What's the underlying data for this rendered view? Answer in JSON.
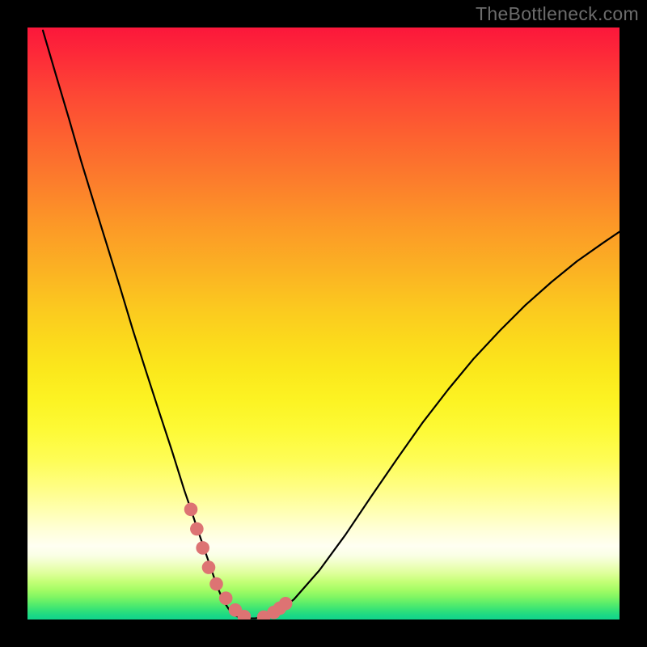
{
  "watermark": "TheBottleneck.com",
  "colors": {
    "page_bg": "#000000",
    "curve_stroke": "#000000",
    "dot_fill": "#dd7373",
    "gradient_top": "#fb173b",
    "gradient_bottom": "#12d48b"
  },
  "chart_data": {
    "type": "line",
    "title": "",
    "xlabel": "",
    "ylabel": "",
    "xlim": [
      0,
      100
    ],
    "ylim": [
      0,
      100
    ],
    "grid": false,
    "series": [
      {
        "name": "bottleneck-curve",
        "x": [
          2.6,
          4.8,
          7.0,
          9.1,
          11.3,
          13.5,
          15.7,
          17.8,
          20.0,
          22.2,
          24.4,
          26.5,
          27.6,
          28.7,
          29.8,
          30.9,
          32.0,
          33.0,
          34.1,
          35.2,
          36.3,
          38.5,
          40.7,
          42.8,
          45.0,
          49.3,
          53.7,
          58.0,
          62.4,
          66.7,
          71.1,
          75.4,
          79.8,
          84.1,
          88.5,
          92.8,
          97.2,
          100.0
        ],
        "y": [
          99.5,
          92.0,
          84.6,
          77.3,
          70.1,
          63.0,
          55.9,
          48.9,
          42.0,
          35.2,
          28.5,
          21.8,
          18.6,
          15.3,
          12.1,
          8.9,
          5.7,
          3.3,
          1.6,
          0.6,
          0.2,
          0.2,
          0.7,
          1.7,
          3.4,
          8.3,
          14.3,
          20.7,
          27.1,
          33.2,
          38.9,
          44.1,
          48.8,
          53.1,
          57.0,
          60.5,
          63.6,
          65.5
        ]
      }
    ],
    "highlighted_points": {
      "name": "dots",
      "x": [
        27.6,
        28.6,
        29.6,
        30.6,
        31.9,
        33.5,
        35.1,
        36.6,
        39.9,
        41.6,
        42.6,
        43.6
      ],
      "y": [
        18.6,
        15.3,
        12.1,
        8.8,
        6.0,
        3.6,
        1.6,
        0.5,
        0.4,
        1.2,
        1.9,
        2.7
      ]
    }
  }
}
